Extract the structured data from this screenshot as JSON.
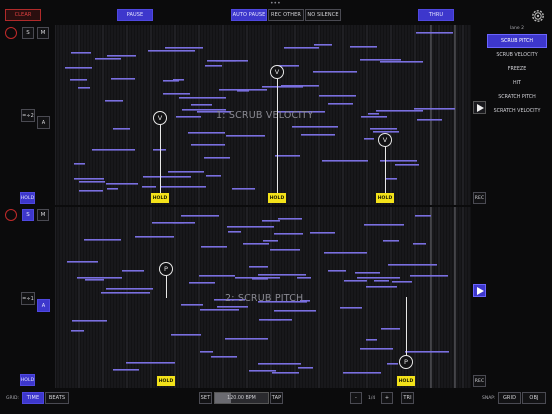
{
  "top": {
    "clear": "CLEAR",
    "pause": "PAUSE",
    "auto_pause": "AUTO PAUSE",
    "rec_other": "REC OTHER",
    "no_silence": "NO SILENCE",
    "thru": "THRU",
    "dots": "•••"
  },
  "lane1": {
    "title": "1: SCRUB VELOCITY",
    "ratio": "=÷2",
    "s_label": "S",
    "m_label": "M",
    "a_label": "A",
    "hold_label": "HOLD",
    "rec_label": "REC",
    "marker_letter": "V",
    "holds": [
      "HOLD",
      "HOLD",
      "HOLD"
    ]
  },
  "lane2": {
    "title": "2: SCRUB PITCH",
    "ratio": "=÷1",
    "s_label": "S",
    "m_label": "M",
    "a_label": "A",
    "hold_label": "HOLD",
    "rec_label": "REC",
    "marker_letter": "P",
    "holds": [
      "HOLD",
      "HOLD"
    ]
  },
  "panel": {
    "header": "lane 2",
    "items": [
      "SCRUB PITCH",
      "SCRUB VELOCITY",
      "FREEZE",
      "HIT",
      "SCRATCH PITCH",
      "SCRATCH VELOCITY"
    ],
    "selected": 0
  },
  "bottom": {
    "grid_label": "GRID:",
    "time": "TIME",
    "beats": "BEATS",
    "set": "SET",
    "bpm": "120.00 BPM",
    "tap": "TAP",
    "minus": "-",
    "fraction": "1/4",
    "plus": "+",
    "tri": "TRI",
    "snap_label": "SNAP:",
    "snap_grid": "GRID",
    "snap_obj": "OBJ"
  },
  "colors": {
    "accent": "#3d37cc",
    "hold": "#f3e21a",
    "record": "#c02a2a",
    "note": "#7a6fe0"
  },
  "icons": {
    "settings": "gear-icon",
    "play": "play-icon"
  }
}
